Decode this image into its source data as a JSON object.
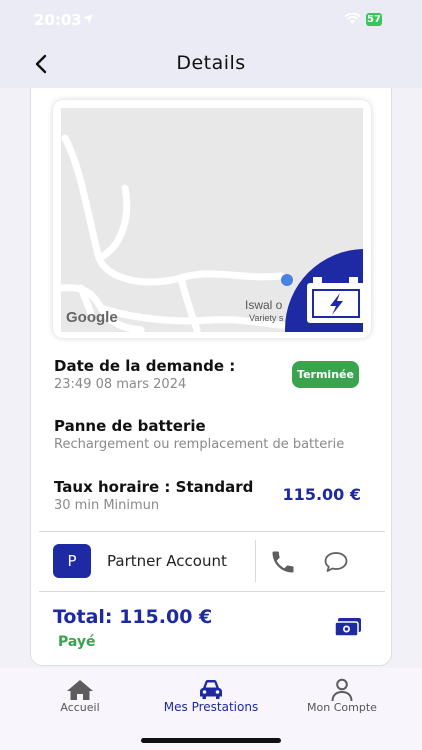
{
  "status_bar": {
    "time": "20:03",
    "battery": "57"
  },
  "header": {
    "title": "Details"
  },
  "map": {
    "place_name": "Iswal o",
    "place_sub": "Variety s",
    "logo_text": "Google"
  },
  "request": {
    "label": "Date de la demande :",
    "date": "23:49 08 mars 2024",
    "status": "Terminée"
  },
  "service": {
    "title": "Panne de batterie",
    "description": "Rechargement ou remplacement de batterie"
  },
  "rate": {
    "label": "Taux horaire : Standard",
    "minimum": "30 min Minimun",
    "price": "115.00 €"
  },
  "partner": {
    "initial": "P",
    "name": "Partner Account"
  },
  "summary": {
    "total": "Total: 115.00 €",
    "payment_status": "Payé"
  },
  "tabs": [
    {
      "label": "Accueil",
      "icon": "home-icon",
      "active": false
    },
    {
      "label": "Mes Prestations",
      "icon": "car-icon",
      "active": true
    },
    {
      "label": "Mon Compte",
      "icon": "person-icon",
      "active": false
    }
  ],
  "colors": {
    "accent": "#1d2aa3",
    "success": "#3aa34d",
    "header_bg": "#ebebf6"
  }
}
